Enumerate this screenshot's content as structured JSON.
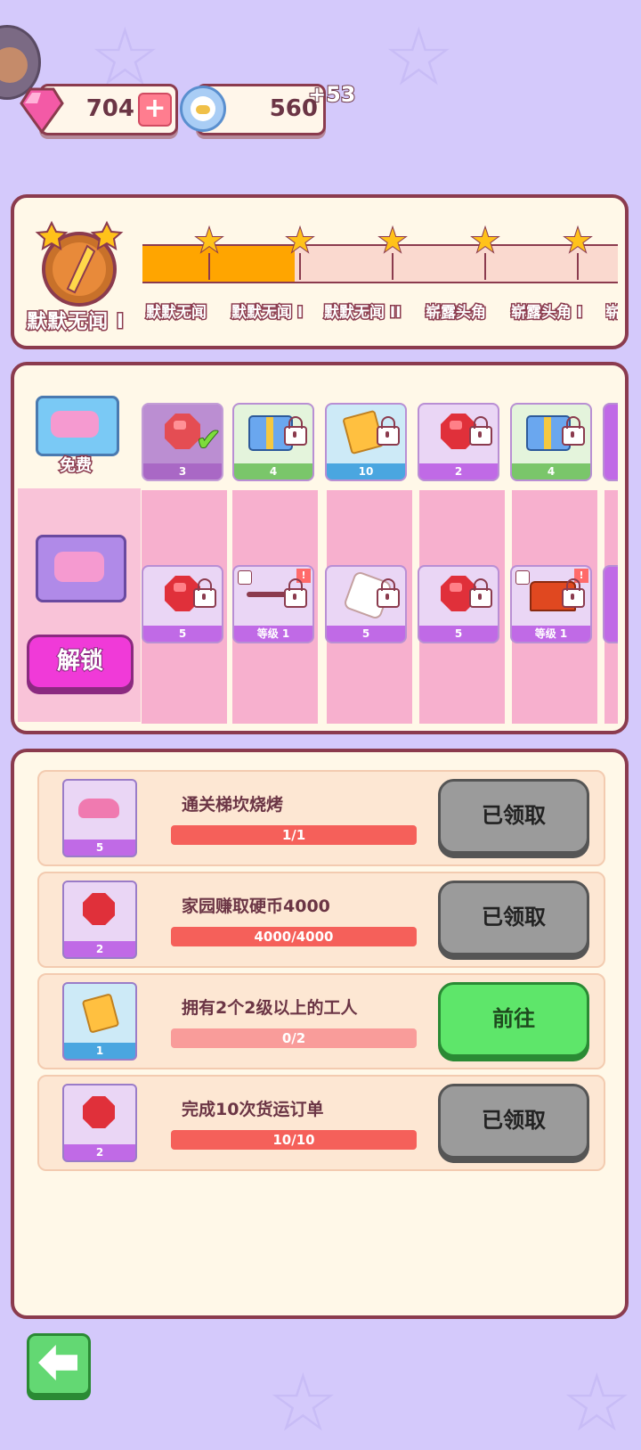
{
  "currency": {
    "gems": "704",
    "coins": "560",
    "coin_bonus": "+53"
  },
  "rank": {
    "current_name": "默默无闻 I",
    "milestones": [
      "默默无闻",
      "默默无闻 I",
      "默默无闻 II",
      "崭露头角",
      "崭露头角 I",
      "崭"
    ],
    "progress_fraction": 0.32
  },
  "pass": {
    "free_label": "免费",
    "unlock_label": "解锁",
    "free_rewards": [
      {
        "icon": "ruby-gem-icon",
        "count": "3",
        "claimed": true,
        "color": "#9b4fc0"
      },
      {
        "icon": "toolbox-key-icon",
        "count": "4",
        "claimed": false,
        "color": "#7ac66a"
      },
      {
        "icon": "gold-ticket-icon",
        "count": "10",
        "claimed": false,
        "color": "#4aa6e0"
      },
      {
        "icon": "ruby-gem-icon",
        "count": "2",
        "claimed": false,
        "color": "#c06ae6"
      },
      {
        "icon": "toolbox-key-icon",
        "count": "4",
        "claimed": false,
        "color": "#7ac66a"
      }
    ],
    "premium_rewards": [
      {
        "icon": "ruby-gem-icon",
        "count": "5"
      },
      {
        "icon": "mustache-skin-icon",
        "count": "等级 1"
      },
      {
        "icon": "puzzle-piece-icon",
        "count": "5"
      },
      {
        "icon": "ruby-gem-icon",
        "count": "5"
      },
      {
        "icon": "treasure-chest-icon",
        "count": "等级 1"
      }
    ]
  },
  "tasks": [
    {
      "title": "通关梯坎烧烤",
      "progress": "1/1",
      "reward_count": "5",
      "reward_icon": "pink-gem-pile-icon",
      "button": "已领取",
      "state": "claimed"
    },
    {
      "title": "家园赚取硬币4000",
      "progress": "4000/4000",
      "reward_count": "2",
      "reward_icon": "ruby-gem-icon",
      "button": "已领取",
      "state": "claimed"
    },
    {
      "title": "拥有2个2级以上的工人",
      "progress": "0/2",
      "reward_count": "1",
      "reward_icon": "gold-ticket-icon",
      "button": "前往",
      "state": "go"
    },
    {
      "title": "完成10次货运订单",
      "progress": "10/10",
      "reward_count": "2",
      "reward_icon": "ruby-gem-icon",
      "button": "已领取",
      "state": "claimed"
    }
  ],
  "colors": {
    "background": "#d4c9fb",
    "panel": "#fff8e8",
    "border": "#8b3b4e",
    "progress_fill": "#ffa500",
    "claimed_button": "#9b9b9b",
    "go_button": "#5ee66a"
  }
}
